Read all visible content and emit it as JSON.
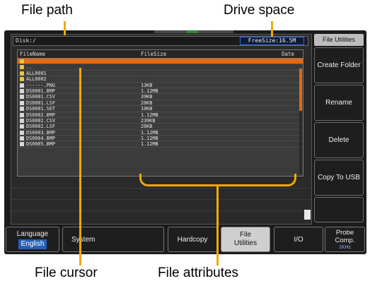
{
  "annotations": {
    "file_path": "File path",
    "drive_space": "Drive space",
    "file_cursor": "File cursor",
    "file_attributes": "File attributes"
  },
  "header": {
    "path": "Disk:/",
    "free_size": "FreeSize:16.5M"
  },
  "file_browser": {
    "columns": {
      "name": "FileName",
      "size": "FileSize",
      "date": "Date"
    },
    "rows": [
      {
        "name": ".",
        "size": "",
        "type": "folder",
        "selected": true
      },
      {
        "name": "..",
        "size": "",
        "type": "folder"
      },
      {
        "name": "ALL0001",
        "size": "",
        "type": "folder"
      },
      {
        "name": "ALL0002",
        "size": "",
        "type": "folder"
      },
      {
        "name": "------.PNG",
        "size": "13KB",
        "type": "file"
      },
      {
        "name": "DS0001.BMP",
        "size": "1.12MB",
        "type": "file"
      },
      {
        "name": "DS0001.CSV",
        "size": "39KB",
        "type": "file"
      },
      {
        "name": "DS0001.LSF",
        "size": "20KB",
        "type": "file"
      },
      {
        "name": "DS0001.SET",
        "size": "10KB",
        "type": "file"
      },
      {
        "name": "DS0002.BMP",
        "size": "1.12MB",
        "type": "file"
      },
      {
        "name": "DS0002.CSV",
        "size": "239KB",
        "type": "file"
      },
      {
        "name": "DS0002.LSF",
        "size": "20KB",
        "type": "file"
      },
      {
        "name": "DS0003.BMP",
        "size": "1.12MB",
        "type": "file"
      },
      {
        "name": "DS0004.BMP",
        "size": "1.12MB",
        "type": "file"
      },
      {
        "name": "DS0005.BMP",
        "size": "1.12MB",
        "type": "file"
      }
    ]
  },
  "side_menu": {
    "title": "File Utilities",
    "create_folder": "Create Folder",
    "rename": "Rename",
    "delete": "Delete",
    "copy_to_usb": "Copy To USB"
  },
  "bottom_menu": {
    "language": "Language",
    "language_value": "English",
    "system": "System",
    "hardcopy": "Hardcopy",
    "file_utilities": "File Utilities",
    "io": "I/O",
    "probe_comp": "Probe Comp.",
    "probe_comp_value": "1KHz"
  },
  "colors": {
    "cursor": "#e26a12",
    "annotation": "#f2a900",
    "highlight_blue": "#2a5fb8"
  }
}
